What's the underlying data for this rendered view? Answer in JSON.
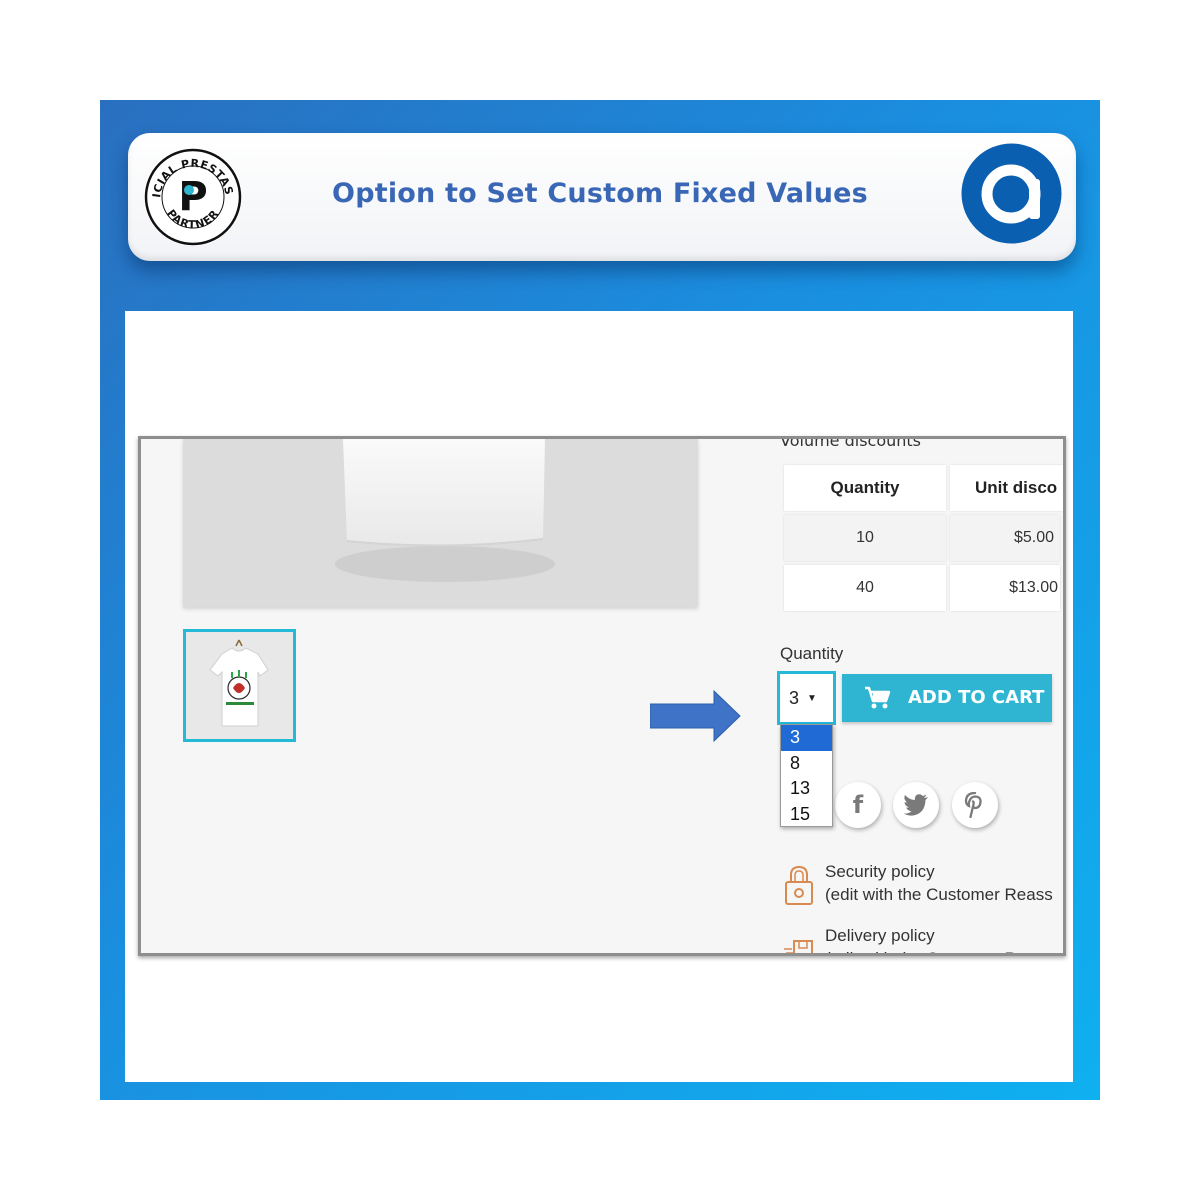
{
  "banner": {
    "title": "Option to Set Custom Fixed Values",
    "badge_top_text": "OFFICIAL PRESTASHOP",
    "badge_bottom_text": "PARTNER",
    "badge_letter": "P",
    "brand_logo_letter": "a",
    "brand_color": "#0a5fb0"
  },
  "product": {
    "volume_discounts_label": "Volume discounts",
    "discount_table": {
      "headers": [
        "Quantity",
        "Unit disco"
      ],
      "rows": [
        [
          "10",
          "$5.00"
        ],
        [
          "40",
          "$13.00"
        ]
      ]
    },
    "quantity_label": "Quantity",
    "quantity_selected": "3",
    "quantity_options": [
      "3",
      "8",
      "13",
      "15"
    ],
    "add_to_cart_label": "ADD TO CART",
    "social_icons": [
      "facebook-icon",
      "twitter-icon",
      "pinterest-icon"
    ],
    "security_policy": {
      "title": "Security policy",
      "subtitle": "(edit with the Customer Reass"
    },
    "delivery_policy": {
      "title": "Delivery policy",
      "subtitle": "(edit with the Customer Reas"
    }
  },
  "colors": {
    "accent": "#2fb5d2",
    "frame_gradient_start": "#2a6fbf",
    "frame_gradient_end": "#0fb0f0",
    "title": "#3a67b5",
    "selected_option": "#1f6ad4"
  }
}
